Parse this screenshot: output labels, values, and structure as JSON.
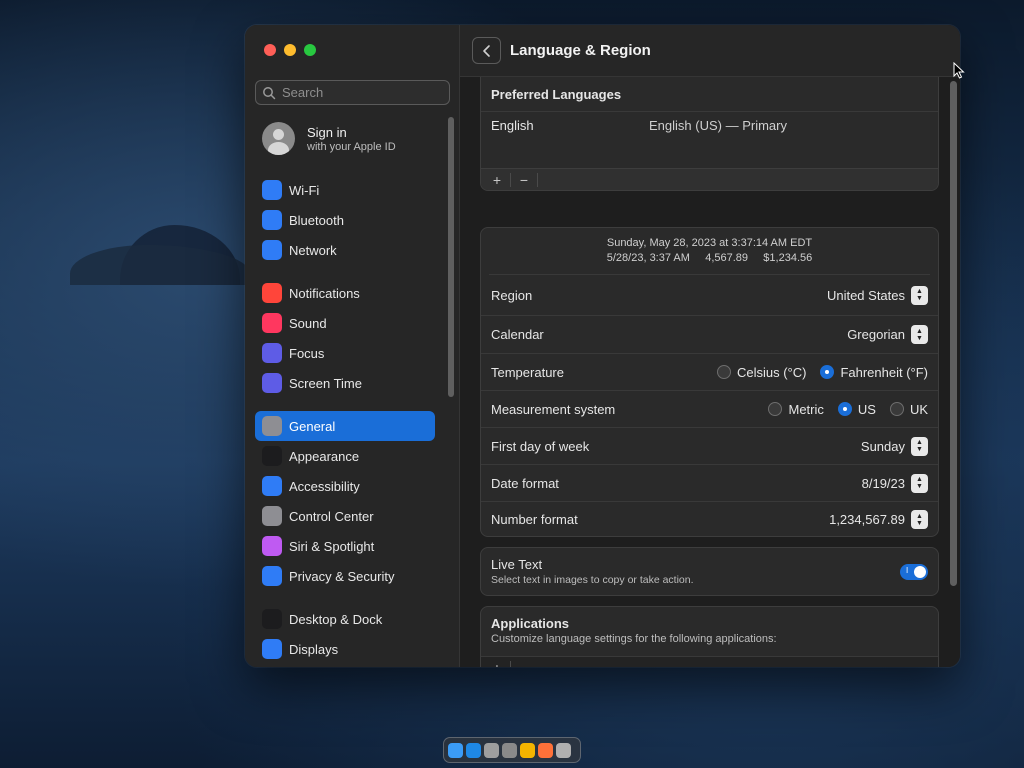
{
  "window": {
    "title": "Language & Region"
  },
  "sidebar": {
    "search_placeholder": "Search",
    "account": {
      "title": "Sign in",
      "subtitle": "with your Apple ID"
    },
    "groups": [
      [
        {
          "label": "Wi-Fi",
          "icon": "wifi-icon",
          "color": "#2f7cf6"
        },
        {
          "label": "Bluetooth",
          "icon": "bluetooth-icon",
          "color": "#2f7cf6"
        },
        {
          "label": "Network",
          "icon": "globe-icon",
          "color": "#2f7cf6"
        }
      ],
      [
        {
          "label": "Notifications",
          "icon": "bell-icon",
          "color": "#ff453a"
        },
        {
          "label": "Sound",
          "icon": "speaker-icon",
          "color": "#ff375f"
        },
        {
          "label": "Focus",
          "icon": "moon-icon",
          "color": "#5e5ce6"
        },
        {
          "label": "Screen Time",
          "icon": "hourglass-icon",
          "color": "#5e5ce6"
        }
      ],
      [
        {
          "label": "General",
          "icon": "gear-icon",
          "color": "#8e8e93",
          "selected": true
        },
        {
          "label": "Appearance",
          "icon": "appearance-icon",
          "color": "#1c1c1e"
        },
        {
          "label": "Accessibility",
          "icon": "accessibility-icon",
          "color": "#2f7cf6"
        },
        {
          "label": "Control Center",
          "icon": "control-center-icon",
          "color": "#8e8e93"
        },
        {
          "label": "Siri & Spotlight",
          "icon": "siri-icon",
          "color": "#bf5af2"
        },
        {
          "label": "Privacy & Security",
          "icon": "hand-icon",
          "color": "#2f7cf6"
        }
      ],
      [
        {
          "label": "Desktop & Dock",
          "icon": "dock-icon",
          "color": "#1c1c1e"
        },
        {
          "label": "Displays",
          "icon": "sun-icon",
          "color": "#2f7cf6"
        }
      ]
    ]
  },
  "preferred_languages": {
    "header": "Preferred Languages",
    "language": "English",
    "detail": "English (US) — Primary",
    "add": "+",
    "remove": "−"
  },
  "preview": {
    "line1": "Sunday, May 28, 2023 at 3:37:14 AM EDT",
    "line2": "5/28/23, 3:37 AM     4,567.89     $1,234.56"
  },
  "settings": {
    "region": {
      "label": "Region",
      "value": "United States"
    },
    "calendar": {
      "label": "Calendar",
      "value": "Gregorian"
    },
    "temperature": {
      "label": "Temperature",
      "options": [
        "Celsius (°C)",
        "Fahrenheit (°F)"
      ],
      "selected": 1
    },
    "measurement": {
      "label": "Measurement system",
      "options": [
        "Metric",
        "US",
        "UK"
      ],
      "selected": 1
    },
    "first_day": {
      "label": "First day of week",
      "value": "Sunday"
    },
    "date_format": {
      "label": "Date format",
      "value": "8/19/23"
    },
    "number_format": {
      "label": "Number format",
      "value": "1,234,567.89"
    }
  },
  "live_text": {
    "title": "Live Text",
    "subtitle": "Select text in images to copy or take action.",
    "enabled": true,
    "toggle_glyph": "I"
  },
  "applications": {
    "title": "Applications",
    "subtitle": "Customize language settings for the following applications:",
    "add": "+",
    "remove": "−"
  },
  "dock": {
    "apps": [
      {
        "name": "finder-icon",
        "color": "#3b9cf7"
      },
      {
        "name": "safari-icon",
        "color": "#1e88e5"
      },
      {
        "name": "launchpad-icon",
        "color": "#9e9e9e"
      },
      {
        "name": "system-settings-icon",
        "color": "#8a8a8a"
      },
      {
        "name": "chrome-icon",
        "color": "#f4b400"
      },
      {
        "name": "firefox-icon",
        "color": "#ff7139"
      },
      {
        "name": "trash-icon",
        "color": "#b0b0b0"
      }
    ]
  }
}
